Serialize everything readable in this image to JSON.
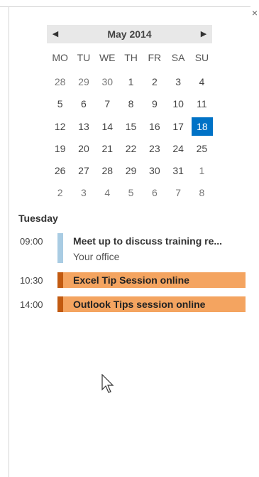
{
  "calendar": {
    "month_label": "May 2014",
    "weekdays": [
      "MO",
      "TU",
      "WE",
      "TH",
      "FR",
      "SA",
      "SU"
    ],
    "weeks": [
      [
        "28",
        "29",
        "30",
        "1",
        "2",
        "3",
        "4"
      ],
      [
        "5",
        "6",
        "7",
        "8",
        "9",
        "10",
        "11"
      ],
      [
        "12",
        "13",
        "14",
        "15",
        "16",
        "17",
        "18"
      ],
      [
        "19",
        "20",
        "21",
        "22",
        "23",
        "24",
        "25"
      ],
      [
        "26",
        "27",
        "28",
        "29",
        "30",
        "31",
        "1"
      ],
      [
        "2",
        "3",
        "4",
        "5",
        "6",
        "7",
        "8"
      ]
    ],
    "today": "18"
  },
  "agenda": {
    "day_label": "Tuesday",
    "events": [
      {
        "time": "09:00",
        "title": "Meet up to discuss training re...",
        "location": "Your office",
        "color": "#a9cce3"
      },
      {
        "time": "10:30",
        "title": "Excel Tip Session online",
        "color": "#f4a460",
        "accent": "#c25a10"
      },
      {
        "time": "14:00",
        "title": "Outlook Tips session online",
        "color": "#f4a460",
        "accent": "#c25a10"
      }
    ]
  },
  "icons": {
    "close": "close-icon",
    "prev": "chevron-left-icon",
    "next": "chevron-right-icon",
    "cursor": "mouse-pointer-icon"
  },
  "glyphs": {
    "close": "×",
    "prev": "◀",
    "next": "▶"
  }
}
